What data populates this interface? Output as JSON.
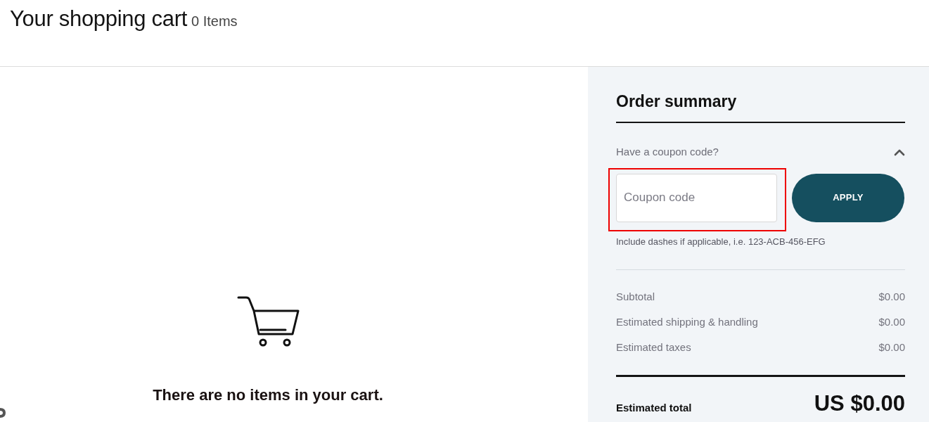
{
  "header": {
    "title": "Your shopping cart",
    "item_count": "0 Items"
  },
  "empty_cart": {
    "message": "There are no items in your cart."
  },
  "order_summary": {
    "title": "Order summary",
    "coupon": {
      "prompt": "Have a coupon code?",
      "expanded": true,
      "placeholder": "Coupon code",
      "highlighted": true,
      "button": "APPLY",
      "hint": "Include dashes if applicable, i.e. 123-ACB-456-EFG"
    },
    "lines": [
      {
        "label": "Subtotal",
        "amount": "$0.00"
      },
      {
        "label": "Estimated shipping & handling",
        "amount": "$0.00"
      },
      {
        "label": "Estimated taxes",
        "amount": "$0.00"
      }
    ],
    "total": {
      "label": "Estimated total",
      "amount": "US $0.00"
    }
  }
}
